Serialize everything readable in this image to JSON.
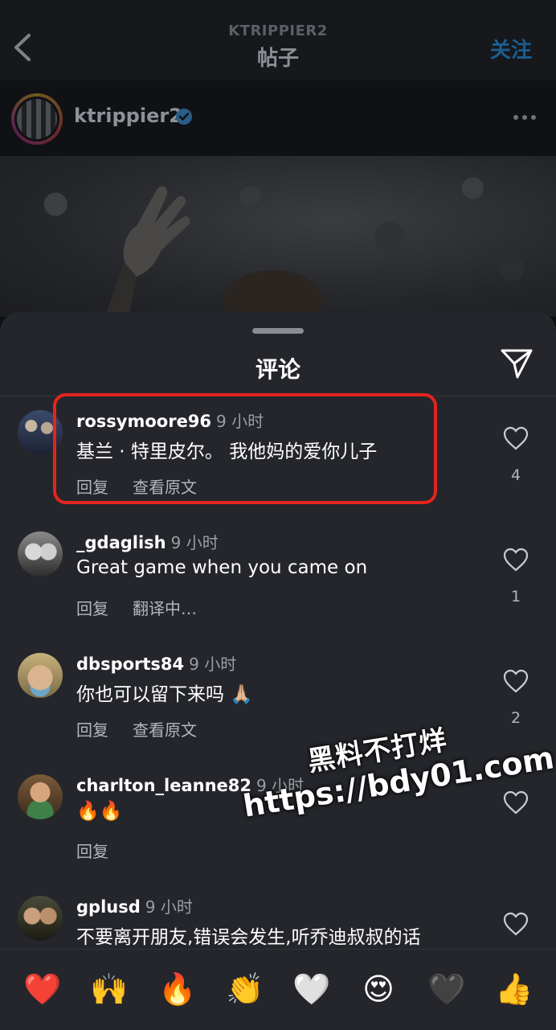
{
  "header": {
    "subtitle": "KTRIPPIER2",
    "title": "帖子",
    "follow_label": "关注"
  },
  "author": {
    "username": "ktrippier2",
    "verified": true
  },
  "sheet": {
    "title": "评论"
  },
  "comments": [
    {
      "username": "rossymoore96",
      "time": "9 小时",
      "text": "基兰 · 特里皮尔。 我他妈的爱你儿子",
      "reply_label": "回复",
      "translate_label": "查看原文",
      "likes": "4",
      "highlighted": true
    },
    {
      "username": "_gdaglish",
      "time": "9 小时",
      "text": "Great game when you came on",
      "reply_label": "回复",
      "translate_label": "翻译中…",
      "likes": "1"
    },
    {
      "username": "dbsports84",
      "time": "9 小时",
      "text": "你也可以留下来吗 🙏🏼",
      "reply_label": "回复",
      "translate_label": "查看原文",
      "likes": "2"
    },
    {
      "username": "charlton_leanne82",
      "time": "9 小时",
      "text": "🔥🔥",
      "reply_label": "回复",
      "translate_label": "",
      "likes": ""
    },
    {
      "username": "gplusd",
      "time": "9 小时",
      "text": "不要离开朋友,错误会发生,听乔迪叔叔的话",
      "reply_label": "",
      "translate_label": "",
      "likes": ""
    }
  ],
  "emoji_bar": [
    "❤️",
    "🙌",
    "🔥",
    "👏",
    "🤍",
    "😍",
    "🖤",
    "👍"
  ],
  "watermark": {
    "line1": "黑料不打烊",
    "line2": "https://bdy01.com"
  },
  "colors": {
    "highlight_border": "#e3241f",
    "follow_accent": "#1c5d8f",
    "sheet_bg": "#24262b"
  }
}
